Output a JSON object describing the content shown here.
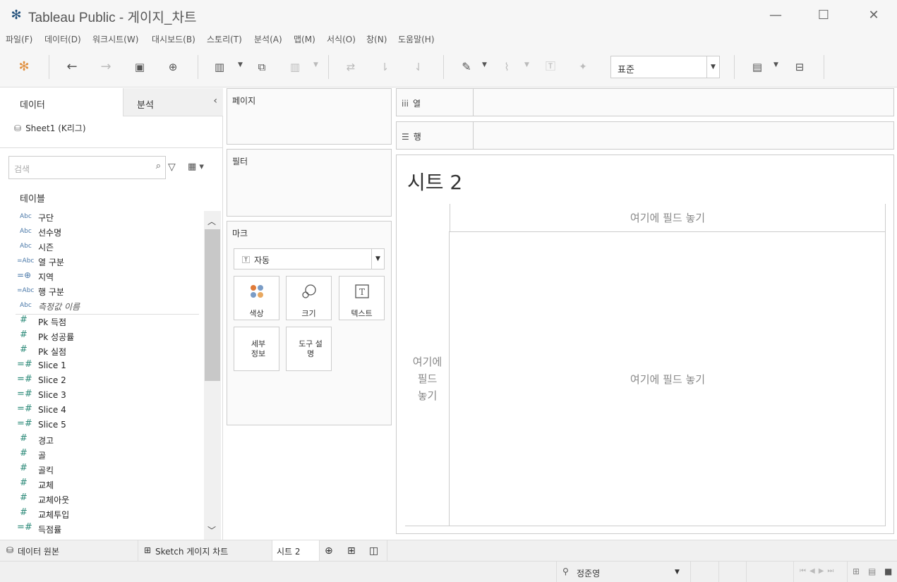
{
  "window": {
    "title": "Tableau Public - 게이지_차트"
  },
  "menu": [
    "파일(F)",
    "데이터(D)",
    "워크시트(W)",
    "대시보드(B)",
    "스토리(T)",
    "분석(A)",
    "맵(M)",
    "서식(O)",
    "창(N)",
    "도움말(H)"
  ],
  "toolbar": {
    "fit": "표준"
  },
  "left": {
    "tab_data": "데이터",
    "tab_analysis": "분석",
    "datasource": "Sheet1 (K리그)",
    "search_placeholder": "검색",
    "tables_label": "테이블",
    "fields": [
      {
        "name": "구단",
        "type": "Abc"
      },
      {
        "name": "선수명",
        "type": "Abc"
      },
      {
        "name": "시즌",
        "type": "Abc"
      },
      {
        "name": "열 구분",
        "type": "=Abc"
      },
      {
        "name": "지역",
        "type": "geo"
      },
      {
        "name": "행 구분",
        "type": "=Abc"
      },
      {
        "name": "측정값 이름",
        "type": "Abc"
      },
      {
        "name": "Pk 득점",
        "type": "#"
      },
      {
        "name": "Pk 성공률",
        "type": "#"
      },
      {
        "name": "Pk 실점",
        "type": "#"
      },
      {
        "name": "Slice 1",
        "type": "=#"
      },
      {
        "name": "Slice 2",
        "type": "=#"
      },
      {
        "name": "Slice 3",
        "type": "=#"
      },
      {
        "name": "Slice 4",
        "type": "=#"
      },
      {
        "name": "Slice 5",
        "type": "=#"
      },
      {
        "name": "경고",
        "type": "#"
      },
      {
        "name": "골",
        "type": "#"
      },
      {
        "name": "골킥",
        "type": "#"
      },
      {
        "name": "교체",
        "type": "#"
      },
      {
        "name": "교체아웃",
        "type": "#"
      },
      {
        "name": "교체투입",
        "type": "#"
      },
      {
        "name": "득점률",
        "type": "=#"
      }
    ]
  },
  "shelves": {
    "pages": "페이지",
    "filters": "필터",
    "marks": "마크",
    "marks_type": "자동",
    "color": "색상",
    "size": "크기",
    "text": "텍스트",
    "detail": "세부\n정보",
    "tooltip": "도구 설\n명",
    "columns": "열",
    "rows": "행"
  },
  "view": {
    "title": "시트 2",
    "drop_top": "여기에 필드 놓기",
    "drop_left": "여기에\n필드\n놓기",
    "drop_main": "여기에 필드 놓기"
  },
  "tabs": {
    "data_source": "데이터 원본",
    "sheet1": "Sketch 게이지 차트",
    "sheet2": "시트 2"
  },
  "status": {
    "user": "정준영"
  }
}
